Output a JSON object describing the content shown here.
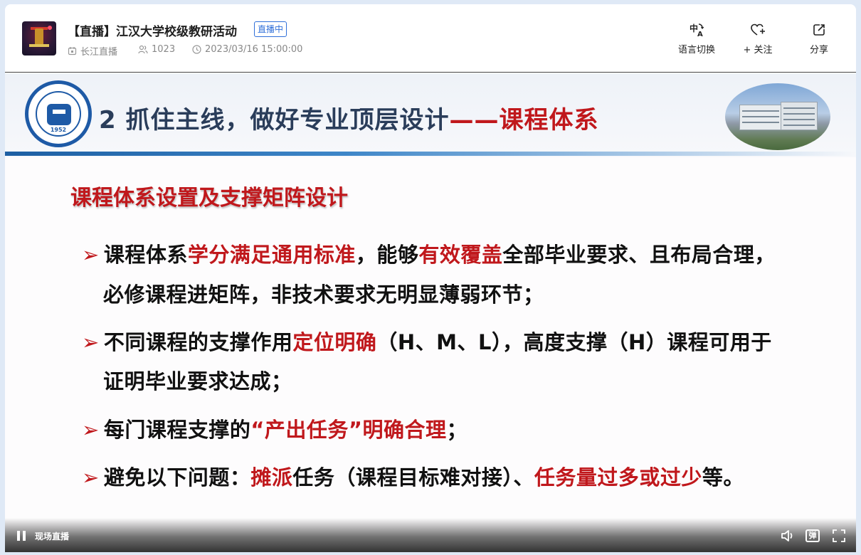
{
  "header": {
    "title": "【直播】江汉大学校级教研活动",
    "badge": "直播中",
    "meta": {
      "channel": "长江直播",
      "viewers": "1023",
      "time": "2023/03/16 15:00:00"
    },
    "actions": [
      {
        "label": "语言切换",
        "icon": "translate-icon"
      },
      {
        "label": "+ 关注",
        "icon": "heart-plus-icon"
      },
      {
        "label": "分享",
        "icon": "share-icon"
      }
    ]
  },
  "slide": {
    "logo_year": "1952",
    "title_main": "2 抓住主线，做好专业顶层设计",
    "title_red": "——课程体系",
    "subtitle": "课程体系设置及支撑矩阵设计",
    "bullets": [
      {
        "p1": "课程体系",
        "r1": "学分满足通用标准",
        "p2": "，能够",
        "r2": "有效覆盖",
        "p3": "全部毕业要求、且布局合理，",
        "cont": "必修课程进矩阵，非技术要求无明显薄弱环节；"
      },
      {
        "p1": "不同课程的支撑作用",
        "r1": "定位明确",
        "p2": "（H、M、L），高度支撑（H）课程可用于",
        "cont": "证明毕业要求达成；"
      },
      {
        "p1": "每门课程支撑的",
        "r1": "“产出任务”明确合理",
        "p2": "；"
      },
      {
        "p1": "避免以下问题：",
        "r1": "摊派",
        "p2": "任务（课程目标难对接）、",
        "r2": "任务量过多或过少",
        "p3": "等。"
      }
    ]
  },
  "player": {
    "live_label": "现场直播",
    "bullet_toggle": "弹"
  }
}
